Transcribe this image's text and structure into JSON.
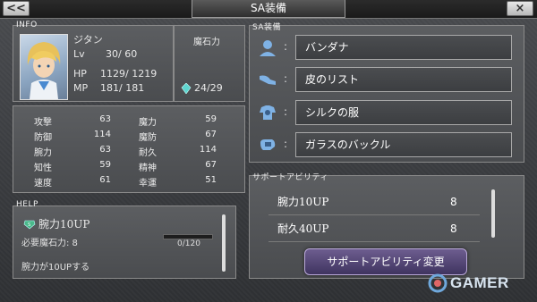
{
  "header": {
    "title": "SA装備",
    "back_label": "<<",
    "close_label": "×"
  },
  "info": {
    "section_label": "INFO",
    "name": "ジタン",
    "lv_label": "Lv",
    "lv_value": "30/ 60",
    "hp_label": "HP",
    "hp_value": "1129/ 1219",
    "mp_label": "MP",
    "mp_value": "181/  181",
    "magicite_label": "魔石力",
    "magicite_value": "24/29"
  },
  "stats": {
    "left": [
      {
        "label": "攻撃",
        "value": "63"
      },
      {
        "label": "防御",
        "value": "114"
      },
      {
        "label": "腕力",
        "value": "63"
      },
      {
        "label": "知性",
        "value": "59"
      },
      {
        "label": "速度",
        "value": "61"
      }
    ],
    "right": [
      {
        "label": "魔力",
        "value": "59"
      },
      {
        "label": "魔防",
        "value": "67"
      },
      {
        "label": "耐久",
        "value": "114"
      },
      {
        "label": "精神",
        "value": "67"
      },
      {
        "label": "幸運",
        "value": "51"
      }
    ]
  },
  "help": {
    "section_label": "HELP",
    "ability_name": "腕力10UP",
    "cost_text": "必要魔石力: 8",
    "progress_text": "0/120",
    "progress_fraction": 0,
    "description": "腕力が10UPする"
  },
  "sa_equip": {
    "section_label": "SA装備",
    "slots": [
      {
        "icon": "head-icon",
        "colon": ":",
        "item": "バンダナ"
      },
      {
        "icon": "arm-icon",
        "colon": ":",
        "item": "皮のリスト"
      },
      {
        "icon": "body-armor-icon",
        "colon": ":",
        "item": "シルクの服"
      },
      {
        "icon": "accessory-icon",
        "colon": ":",
        "item": "ガラスのバックル"
      }
    ]
  },
  "support": {
    "section_label": "サポートアビリティ",
    "abilities": [
      {
        "name": "腕力10UP",
        "cost": "8"
      },
      {
        "name": "耐久40UP",
        "cost": "8"
      }
    ],
    "change_button": "サポートアビリティ変更"
  },
  "watermark": {
    "text": "GAMER"
  }
}
